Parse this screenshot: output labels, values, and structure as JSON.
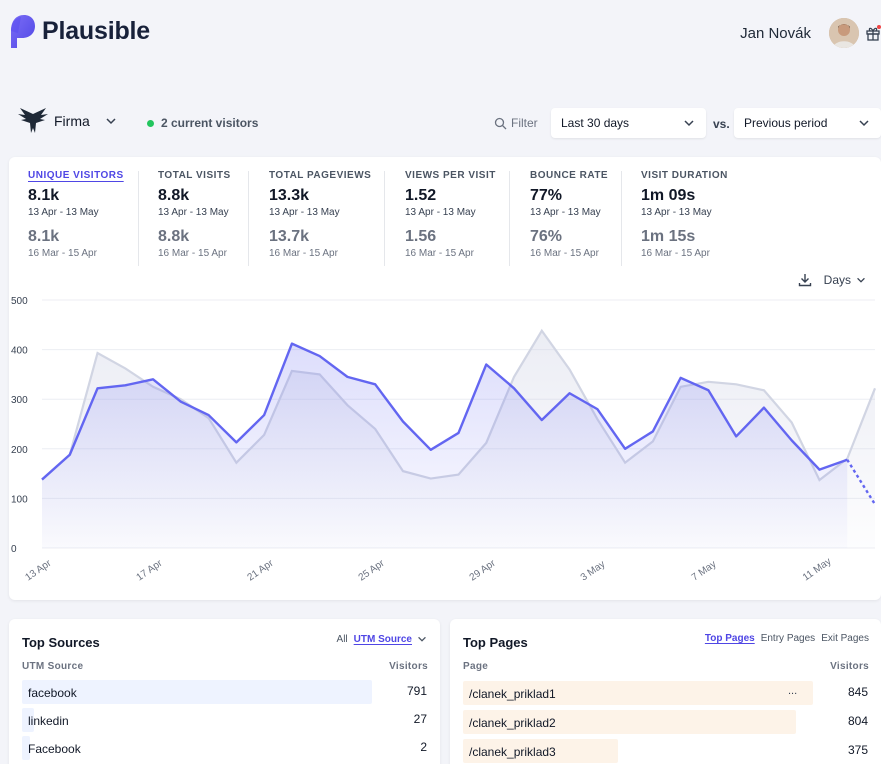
{
  "header": {
    "app_name": "Plausible",
    "user_name": "Jan Novák"
  },
  "toolbar": {
    "site_name": "Firma",
    "current_visitors": "2 current visitors",
    "filter_label": "Filter",
    "period_select": "Last 30 days",
    "vs_label": "vs.",
    "compare_select": "Previous period"
  },
  "metrics": [
    {
      "label": "UNIQUE VISITORS",
      "value": "8.1k",
      "range": "13 Apr - 13 May",
      "prev_value": "8.1k",
      "prev_range": "16 Mar - 15 Apr"
    },
    {
      "label": "TOTAL VISITS",
      "value": "8.8k",
      "range": "13 Apr - 13 May",
      "prev_value": "8.8k",
      "prev_range": "16 Mar - 15 Apr"
    },
    {
      "label": "TOTAL PAGEVIEWS",
      "value": "13.3k",
      "range": "13 Apr - 13 May",
      "prev_value": "13.7k",
      "prev_range": "16 Mar - 15 Apr"
    },
    {
      "label": "VIEWS PER VISIT",
      "value": "1.52",
      "range": "13 Apr - 13 May",
      "prev_value": "1.56",
      "prev_range": "16 Mar - 15 Apr"
    },
    {
      "label": "BOUNCE RATE",
      "value": "77%",
      "range": "13 Apr - 13 May",
      "prev_value": "76%",
      "prev_range": "16 Mar - 15 Apr"
    },
    {
      "label": "VISIT DURATION",
      "value": "1m 09s",
      "range": "13 Apr - 13 May",
      "prev_value": "1m 15s",
      "prev_range": "16 Mar - 15 Apr"
    }
  ],
  "interval_select": "Days",
  "chart_data": {
    "type": "line",
    "x_ticks": [
      "13 Apr",
      "17 Apr",
      "21 Apr",
      "25 Apr",
      "29 Apr",
      "3 May",
      "7 May",
      "11 May"
    ],
    "y_ticks": [
      0,
      100,
      200,
      300,
      400,
      500
    ],
    "ylim": [
      0,
      500
    ],
    "grid": true,
    "series": [
      {
        "values": [
          138,
          188,
          322,
          328,
          340,
          295,
          268,
          213,
          268,
          412,
          387,
          345,
          330,
          255,
          198,
          232,
          370,
          322,
          258,
          312,
          280,
          200,
          235,
          343,
          318,
          225,
          283,
          217,
          158,
          178,
          88
        ],
        "color": "#6366f1"
      },
      {
        "values": [
          138,
          188,
          393,
          362,
          325,
          300,
          262,
          172,
          228,
          357,
          350,
          288,
          240,
          155,
          140,
          148,
          212,
          345,
          438,
          360,
          260,
          172,
          215,
          325,
          335,
          330,
          318,
          253,
          137,
          180,
          322
        ],
        "color": "#d1d5e3"
      }
    ]
  },
  "sources": {
    "title": "Top Sources",
    "tab_all": "All",
    "tab_active": "UTM Source",
    "col_label": "UTM Source",
    "col_value": "Visitors",
    "rows": [
      {
        "label": "facebook",
        "value": "791",
        "fraction": 1.0
      },
      {
        "label": "linkedin",
        "value": "27",
        "fraction": 0.034
      },
      {
        "label": "Facebook",
        "value": "2",
        "fraction": 0.003
      }
    ]
  },
  "pages": {
    "title": "Top Pages",
    "tab_active": "Top Pages",
    "tab_entry": "Entry Pages",
    "tab_exit": "Exit Pages",
    "col_label": "Page",
    "col_value": "Visitors",
    "rows": [
      {
        "label": "/clanek_priklad1",
        "value": "845",
        "fraction": 1.0,
        "more": "..."
      },
      {
        "label": "/clanek_priklad2",
        "value": "804",
        "fraction": 0.951
      },
      {
        "label": "/clanek_priklad3",
        "value": "375",
        "fraction": 0.444
      }
    ]
  },
  "colors": {
    "accent": "#4f46e5",
    "source_bar": "#eef3ff",
    "page_bar": "#fdf3e8",
    "online": "#22c55e"
  }
}
